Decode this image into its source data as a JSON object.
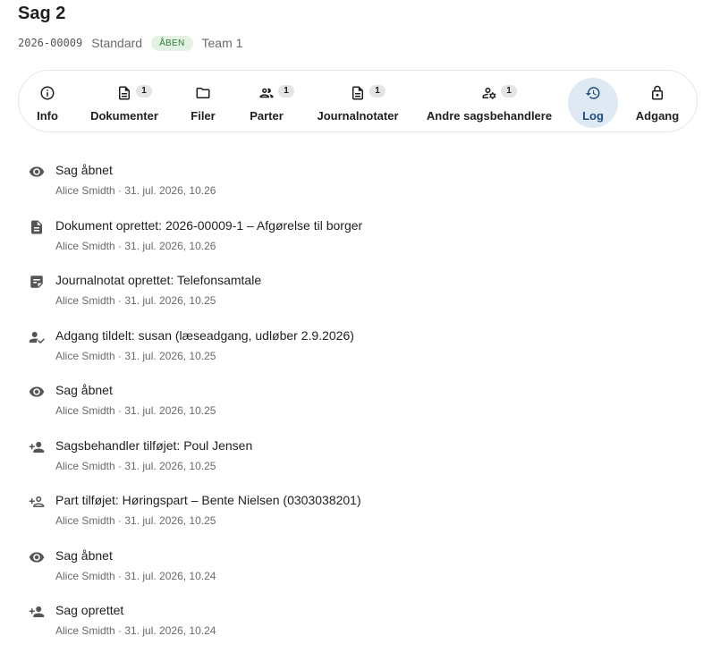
{
  "case": {
    "title": "Sag 2",
    "number": "2026-00009",
    "type": "Standard",
    "status": "ÅBEN",
    "team": "Team 1"
  },
  "tabs": [
    {
      "label": "Info",
      "icon": "info-icon",
      "count": ""
    },
    {
      "label": "Dokumenter",
      "icon": "document-icon",
      "count": "1"
    },
    {
      "label": "Filer",
      "icon": "folder-icon",
      "count": ""
    },
    {
      "label": "Parter",
      "icon": "people-icon",
      "count": "1"
    },
    {
      "label": "Journalnotater",
      "icon": "note-icon",
      "count": "1"
    },
    {
      "label": "Andre sagsbehandlere",
      "icon": "user-gear-icon",
      "count": "1"
    },
    {
      "label": "Log",
      "icon": "history-icon",
      "count": "",
      "active": true
    },
    {
      "label": "Adgang",
      "icon": "lock-icon",
      "count": ""
    }
  ],
  "log": [
    {
      "icon": "eye-icon",
      "title": "Sag åbnet",
      "meta": "Alice Smidth · 31. jul. 2026, 10.26"
    },
    {
      "icon": "document-icon",
      "title": "Dokument oprettet: 2026-00009-1 – Afgørelse til borger",
      "meta": "Alice Smidth · 31. jul. 2026, 10.26"
    },
    {
      "icon": "note-icon",
      "title": "Journalnotat oprettet: Telefonsamtale",
      "meta": "Alice Smidth · 31. jul. 2026, 10.25"
    },
    {
      "icon": "user-check-icon",
      "title": "Adgang tildelt: susan (læseadgang, udløber 2.9.2026)",
      "meta": "Alice Smidth · 31. jul. 2026, 10.25"
    },
    {
      "icon": "eye-icon",
      "title": "Sag åbnet",
      "meta": "Alice Smidth · 31. jul. 2026, 10.25"
    },
    {
      "icon": "person-add-icon",
      "title": "Sagsbehandler tilføjet: Poul Jensen",
      "meta": "Alice Smidth · 31. jul. 2026, 10.25"
    },
    {
      "icon": "person-add-outline-icon",
      "title": "Part tilføjet: Høringspart – Bente Nielsen (0303038201)",
      "meta": "Alice Smidth · 31. jul. 2026, 10.25"
    },
    {
      "icon": "eye-icon",
      "title": "Sag åbnet",
      "meta": "Alice Smidth · 31. jul. 2026, 10.24"
    },
    {
      "icon": "person-add-icon",
      "title": "Sag oprettet",
      "meta": "Alice Smidth · 31. jul. 2026, 10.24"
    }
  ]
}
